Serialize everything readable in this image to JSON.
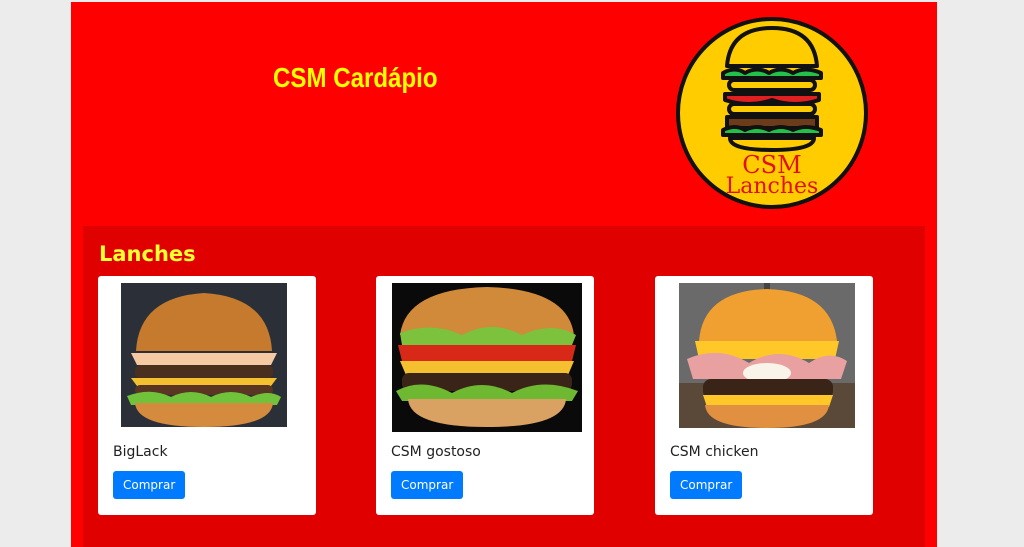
{
  "header": {
    "title": "CSM Cardápio",
    "logo_text_line1": "CSM",
    "logo_text_line2": "Lanches"
  },
  "section": {
    "title": "Lanches",
    "items": [
      {
        "name": "BigLack",
        "button_label": "Comprar"
      },
      {
        "name": "CSM gostoso",
        "button_label": "Comprar"
      },
      {
        "name": "CSM chicken",
        "button_label": "Comprar"
      }
    ]
  },
  "colors": {
    "page_bg": "#ff0000",
    "section_bg": "#e00000",
    "title_yellow": "#ffff00",
    "button_blue": "#007bff",
    "logo_yellow": "#ffcc00"
  }
}
